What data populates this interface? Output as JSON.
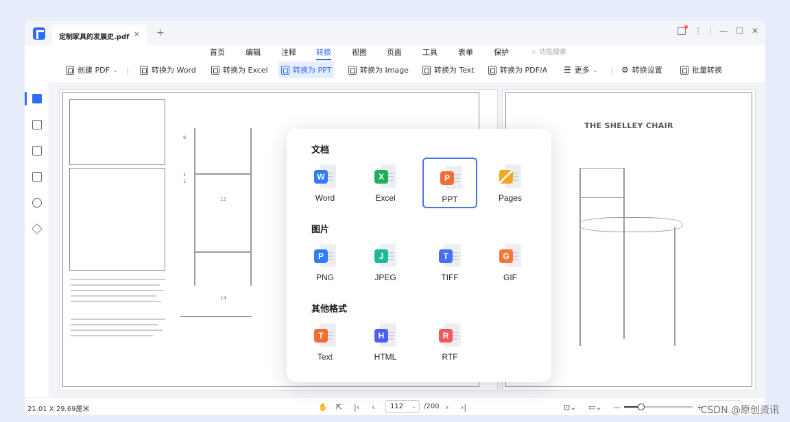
{
  "tab": {
    "title": "定制家具的发展史.pdf",
    "close": "×",
    "new_tab": "+"
  },
  "window_controls": {
    "more": "⋮",
    "minimize": "—",
    "maximize": "☐",
    "close": "✕"
  },
  "menu": {
    "items": [
      "首页",
      "编辑",
      "注释",
      "转换",
      "视图",
      "页面",
      "工具",
      "表单",
      "保护"
    ],
    "active": "转换",
    "search_placeholder": "功能搜索"
  },
  "toolbar": {
    "create_pdf": "创建 PDF",
    "to_word": "转换为 Word",
    "to_excel": "转换为 Excel",
    "to_ppt": "转换为 PPT",
    "to_image": "转换为 Image",
    "to_text": "转换为 Text",
    "to_pdfa": "转换为 PDF/A",
    "more": "更多",
    "settings": "转换设置",
    "batch": "批量转换"
  },
  "document": {
    "chair_title": "THE SHELLEY CHAIR",
    "dims": [
      "6",
      "1",
      "1",
      "12",
      "14"
    ]
  },
  "popover": {
    "sections": [
      {
        "title": "文档",
        "formats": [
          {
            "label": "Word",
            "letter": "W",
            "color": "#2f7cf6"
          },
          {
            "label": "Excel",
            "letter": "X",
            "color": "#1fae5b"
          },
          {
            "label": "PPT",
            "letter": "P",
            "color": "#f36c32",
            "selected": true
          },
          {
            "label": "Pages",
            "letter": "",
            "color": "#f5a623"
          }
        ]
      },
      {
        "title": "图片",
        "formats": [
          {
            "label": "PNG",
            "letter": "P",
            "color": "#2f7cf6"
          },
          {
            "label": "JPEG",
            "letter": "J",
            "color": "#1fb894"
          },
          {
            "label": "TIFF",
            "letter": "T",
            "color": "#4a6ef5"
          },
          {
            "label": "GIF",
            "letter": "G",
            "color": "#f3773a"
          }
        ]
      },
      {
        "title": "其他格式",
        "formats": [
          {
            "label": "Text",
            "letter": "T",
            "color": "#f36c32"
          },
          {
            "label": "HTML",
            "letter": "H",
            "color": "#4a5ef0"
          },
          {
            "label": "RTF",
            "letter": "R",
            "color": "#f05a5a"
          }
        ]
      }
    ]
  },
  "status": {
    "page_size": "21.01 X 29.69厘米",
    "current_page": "112",
    "total_pages": "/200"
  },
  "watermark": "CSDN @原创资讯"
}
